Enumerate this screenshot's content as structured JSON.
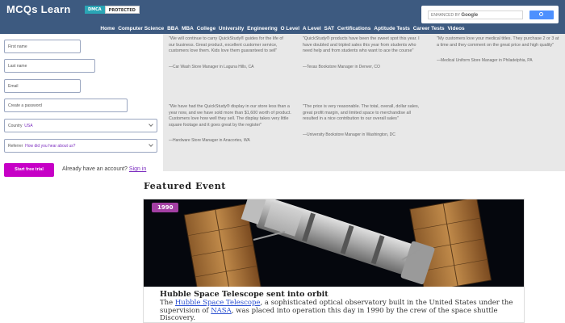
{
  "header": {
    "logo": "MCQs Learn",
    "dmca_left": "DMCA",
    "dmca_right": "PROTECTED",
    "search_enhanced": "ENHANCED BY",
    "search_brand": "Google"
  },
  "nav": {
    "items": [
      "Home",
      "Computer Science",
      "BBA",
      "MBA",
      "College",
      "University",
      "Engineering",
      "O Level",
      "A Level",
      "SAT",
      "Certifications",
      "Aptitude Tests",
      "Career Tests",
      "Videos"
    ]
  },
  "form": {
    "first_name": "First name",
    "last_name": "Last name",
    "email": "Email",
    "password": "Create a password",
    "country_label": "Country",
    "country_value": "USA",
    "referrer_label": "Referrer",
    "referrer_value": "How did you hear about us?",
    "start_button": "Start free trial",
    "already_text": "Already have an account?",
    "sign_in": "Sign in"
  },
  "testimonials": [
    {
      "quote": "\"We will continue to carry QuickStudy® guides for the life of our business. Great product, excellent customer service, customers love them. Kids love them guaranteed to sell\"",
      "by": "—Car Wash Store Manager in Laguna Hills, CA"
    },
    {
      "quote": "\"QuickStudy® products have been the sweet spot this year. I have doubled and tripled sales this year from students who need help and from students who want to ace the course\"",
      "by": "—Texas Bookstore Manager in Denver, CO"
    },
    {
      "quote": "\"My customers love your medical titles. They purchase 2 or 3 at a time and they comment on the great price and high quality\"",
      "by": "—Medical Uniform Store Manager in Philadelphia, PA"
    },
    {
      "quote": "\"We have had the QuickStudy® display in our store less than a year now, and we have sold more than $1,600 worth of product. Customers love how well they sell. The display takes very little square footage and it goes great by the register\"",
      "by": "—Hardware Store Manager in Anacortes, WA"
    },
    {
      "quote": "\"The price is very reasonable. The total, overall, dollar sales, great profit margin, and limited space to merchandise all resulted in a nice contribution to our overall sales\"",
      "by": "—University Bookstore Manager in Washington, DC"
    }
  ],
  "featured": {
    "heading": "Featured Event",
    "year": "1990",
    "title": "Hubble Space Telescope sent into orbit",
    "body_1": "The ",
    "link_1": "Hubble Space Telescope",
    "body_2": ", a sophisticated optical observatory built in the United States under the supervision of ",
    "link_2": "NASA",
    "body_3": ", was placed into operation this day in 1990 by the crew of the space shuttle Discovery."
  },
  "colors": {
    "header": "#3d5a80",
    "accent": "#c600c6",
    "year_badge": "#a33fa3",
    "testimonial_bg": "#e8e8e8"
  }
}
